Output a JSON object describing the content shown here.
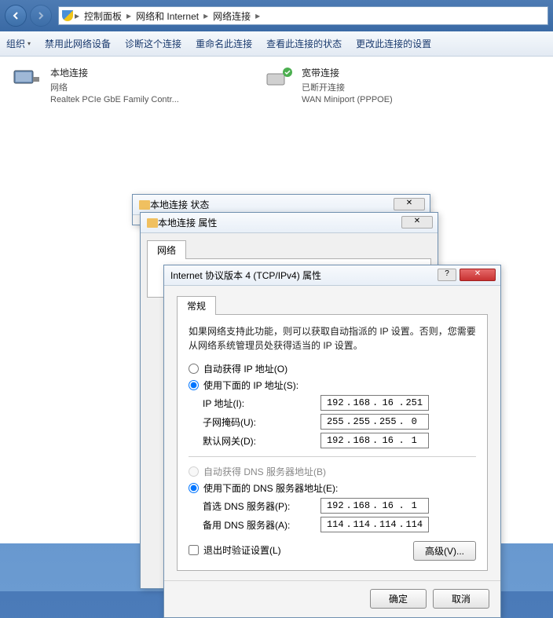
{
  "breadcrumb": {
    "items": [
      "控制面板",
      "网络和 Internet",
      "网络连接"
    ]
  },
  "toolbar": {
    "org": "组织",
    "disable": "禁用此网络设备",
    "diag": "诊断这个连接",
    "rename": "重命名此连接",
    "status": "查看此连接的状态",
    "change": "更改此连接的设置"
  },
  "connections": [
    {
      "name": "本地连接",
      "sub1": "网络",
      "sub2": "Realtek PCIe GbE Family Contr..."
    },
    {
      "name": "宽带连接",
      "sub1": "已断开连接",
      "sub2": "WAN Miniport (PPPOE)"
    }
  ],
  "dlg1": {
    "title": "本地连接 状态"
  },
  "dlg2": {
    "title": "本地连接 属性",
    "tab": "网络"
  },
  "ipv4": {
    "title": "Internet 协议版本 4 (TCP/IPv4) 属性",
    "tab": "常规",
    "desc": "如果网络支持此功能，则可以获取自动指派的 IP 设置。否则，您需要从网络系统管理员处获得适当的 IP 设置。",
    "auto_ip": "自动获得 IP 地址(O)",
    "manual_ip": "使用下面的 IP 地址(S):",
    "ip_label": "IP 地址(I):",
    "ip": [
      "192",
      "168",
      "16",
      "251"
    ],
    "mask_label": "子网掩码(U):",
    "mask": [
      "255",
      "255",
      "255",
      "0"
    ],
    "gw_label": "默认网关(D):",
    "gw": [
      "192",
      "168",
      "16",
      "1"
    ],
    "auto_dns": "自动获得 DNS 服务器地址(B)",
    "manual_dns": "使用下面的 DNS 服务器地址(E):",
    "dns1_label": "首选 DNS 服务器(P):",
    "dns1": [
      "192",
      "168",
      "16",
      "1"
    ],
    "dns2_label": "备用 DNS 服务器(A):",
    "dns2": [
      "114",
      "114",
      "114",
      "114"
    ],
    "validate": "退出时验证设置(L)",
    "advanced": "高级(V)...",
    "ok": "确定",
    "cancel": "取消"
  }
}
